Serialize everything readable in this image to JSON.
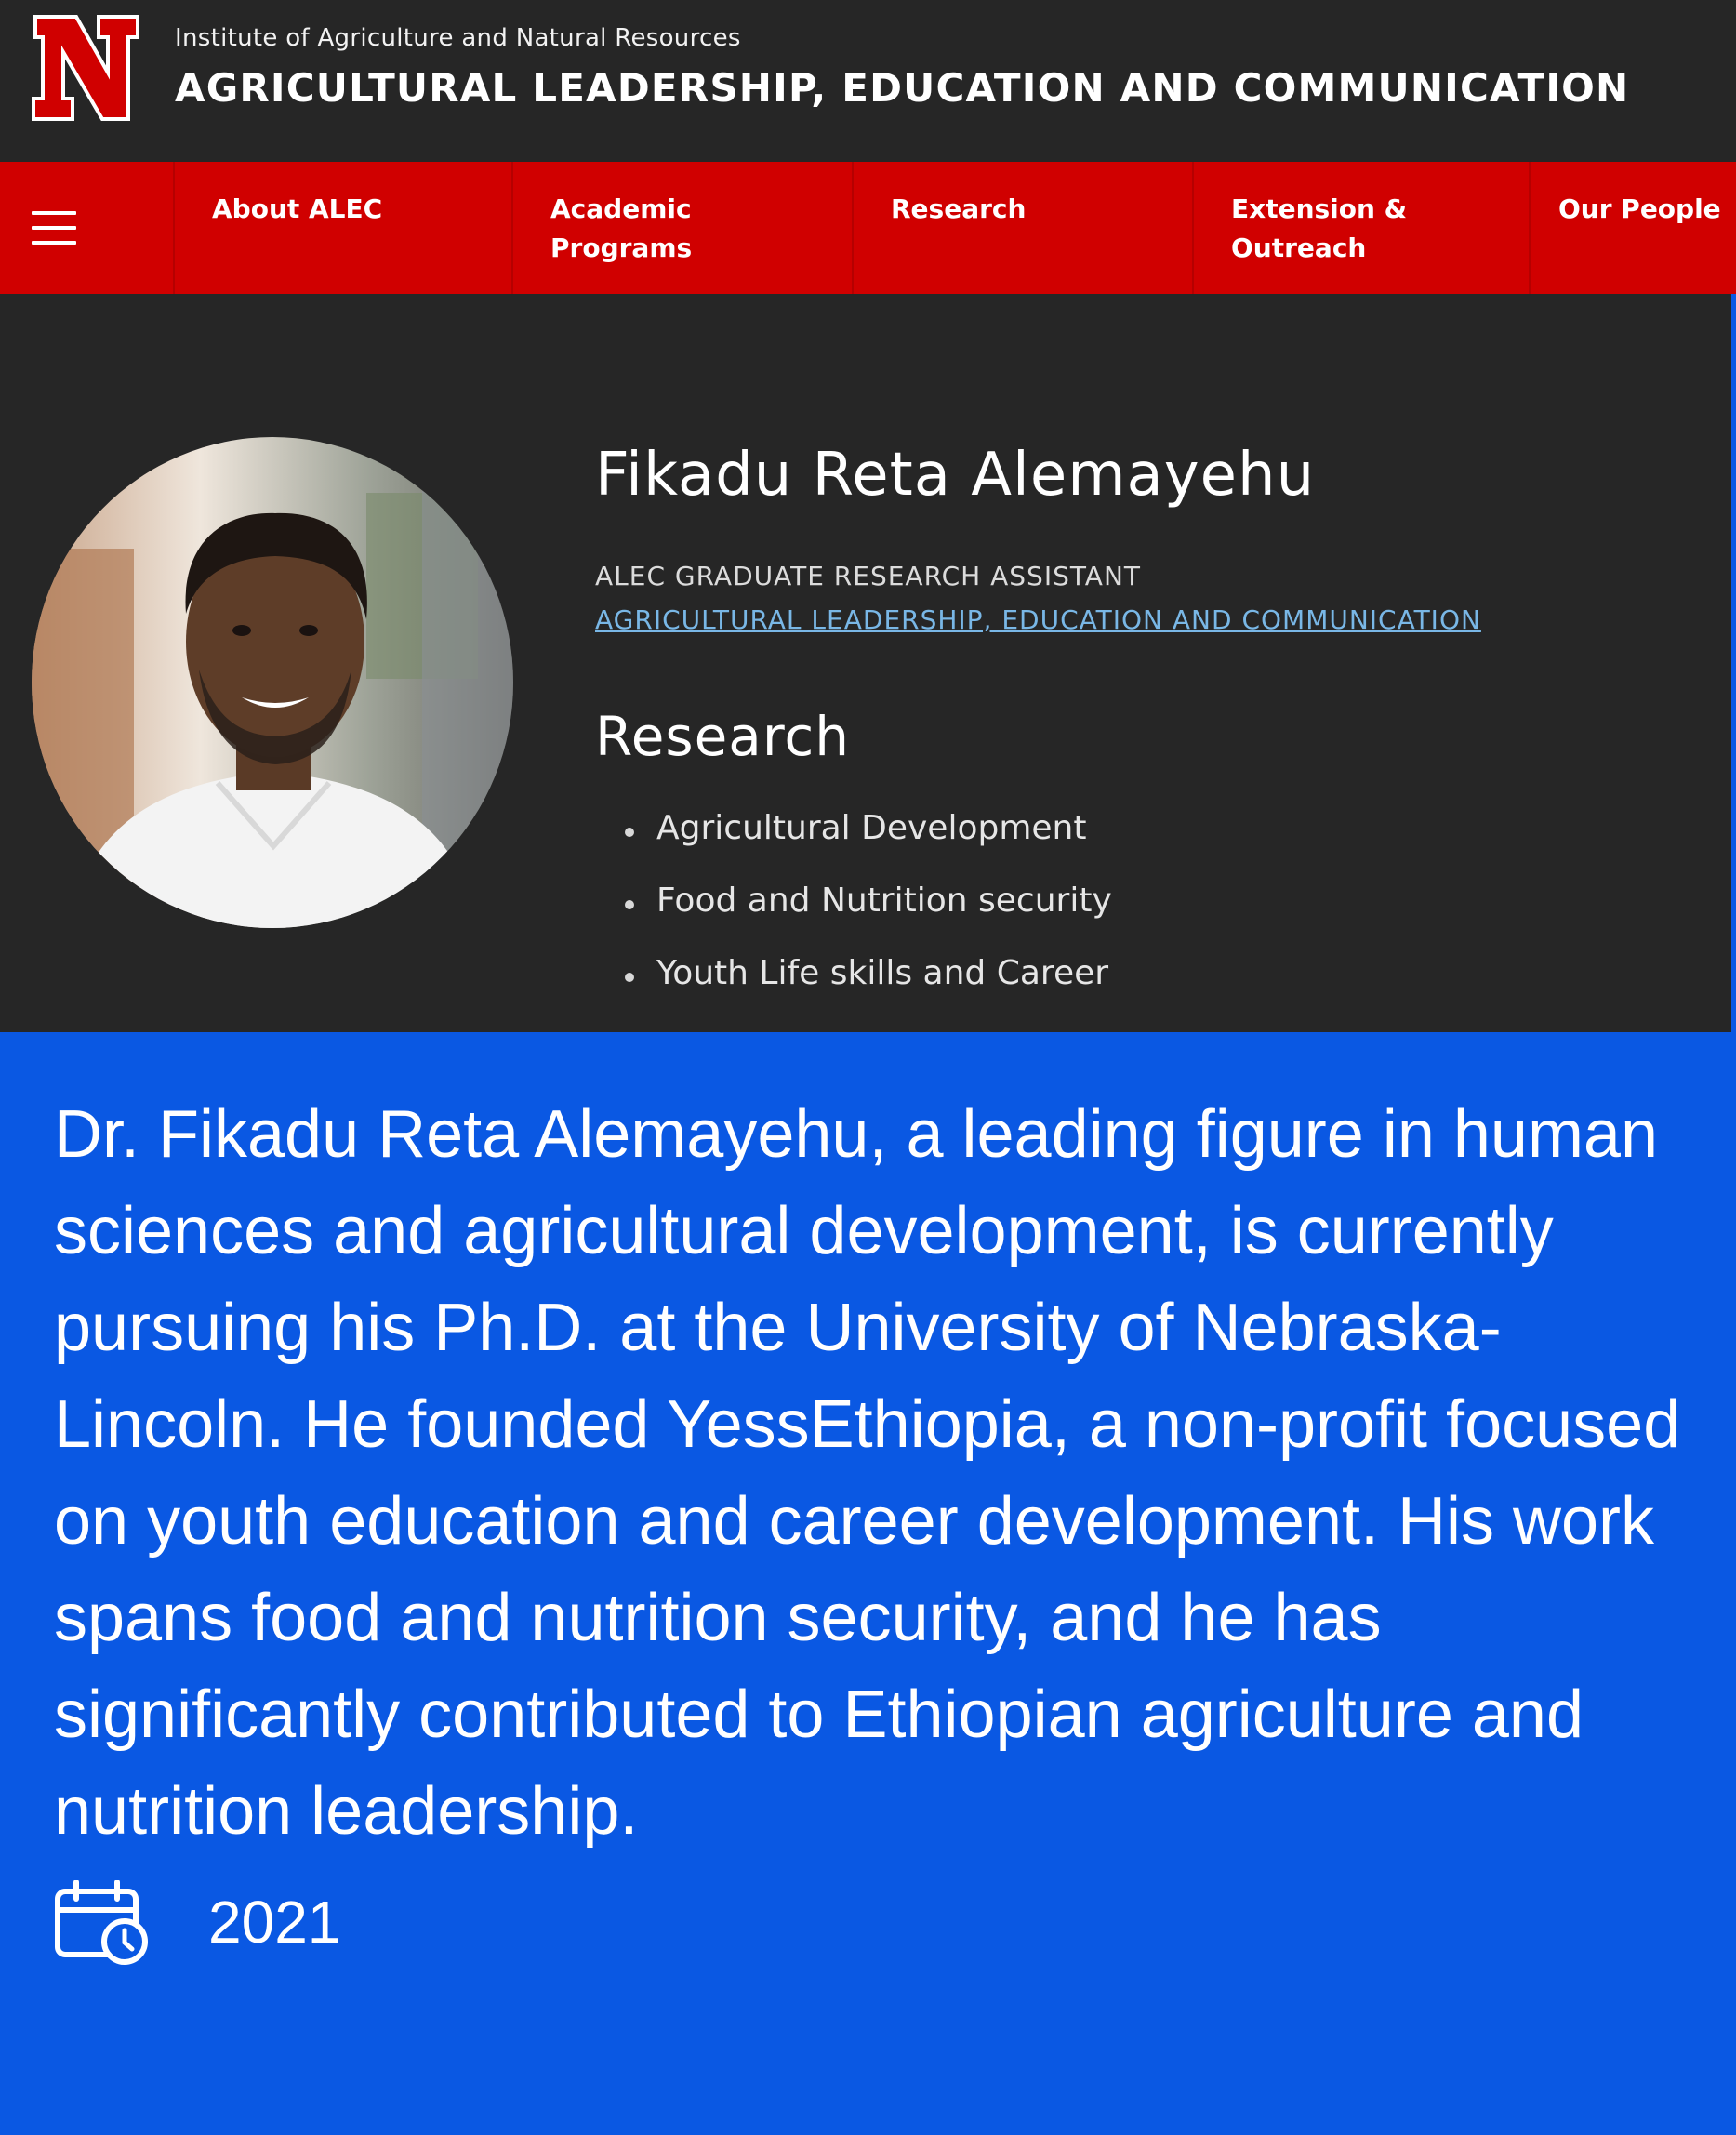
{
  "header": {
    "logo_letter": "N",
    "institute": "Institute of Agriculture and Natural Resources",
    "department": "AGRICULTURAL LEADERSHIP, EDUCATION AND COMMUNICATION"
  },
  "nav": {
    "menu_icon": "hamburger-icon",
    "items": [
      {
        "label": "About ALEC"
      },
      {
        "label": "Academic Programs"
      },
      {
        "label": "Research"
      },
      {
        "label": "Extension & Outreach"
      },
      {
        "label": "Our People"
      }
    ]
  },
  "profile": {
    "name": "Fikadu Reta Alemayehu",
    "role": "ALEC GRADUATE RESEARCH ASSISTANT",
    "department_link": "AGRICULTURAL LEADERSHIP, EDUCATION AND COMMUNICATION",
    "research_heading": "Research",
    "research_items": [
      "Agricultural Development",
      "Food and Nutrition security",
      "Youth Life skills and Career"
    ]
  },
  "bio": {
    "text": "Dr. Fikadu Reta Alemayehu, a leading figure in human sciences and agricultural development, is currently pursuing his Ph.D. at the University of Nebraska-Lincoln. He founded YessEthiopia, a non-profit focused on youth education and career development. His work spans food and nutrition security, and he has significantly contributed to Ethiopian agriculture and nutrition leadership.",
    "year_icon": "calendar-clock-icon",
    "year": "2021"
  },
  "colors": {
    "header_bg": "#262626",
    "nav_red": "#d00000",
    "link_blue": "#79b7e6",
    "panel_blue": "#0a58e3"
  }
}
